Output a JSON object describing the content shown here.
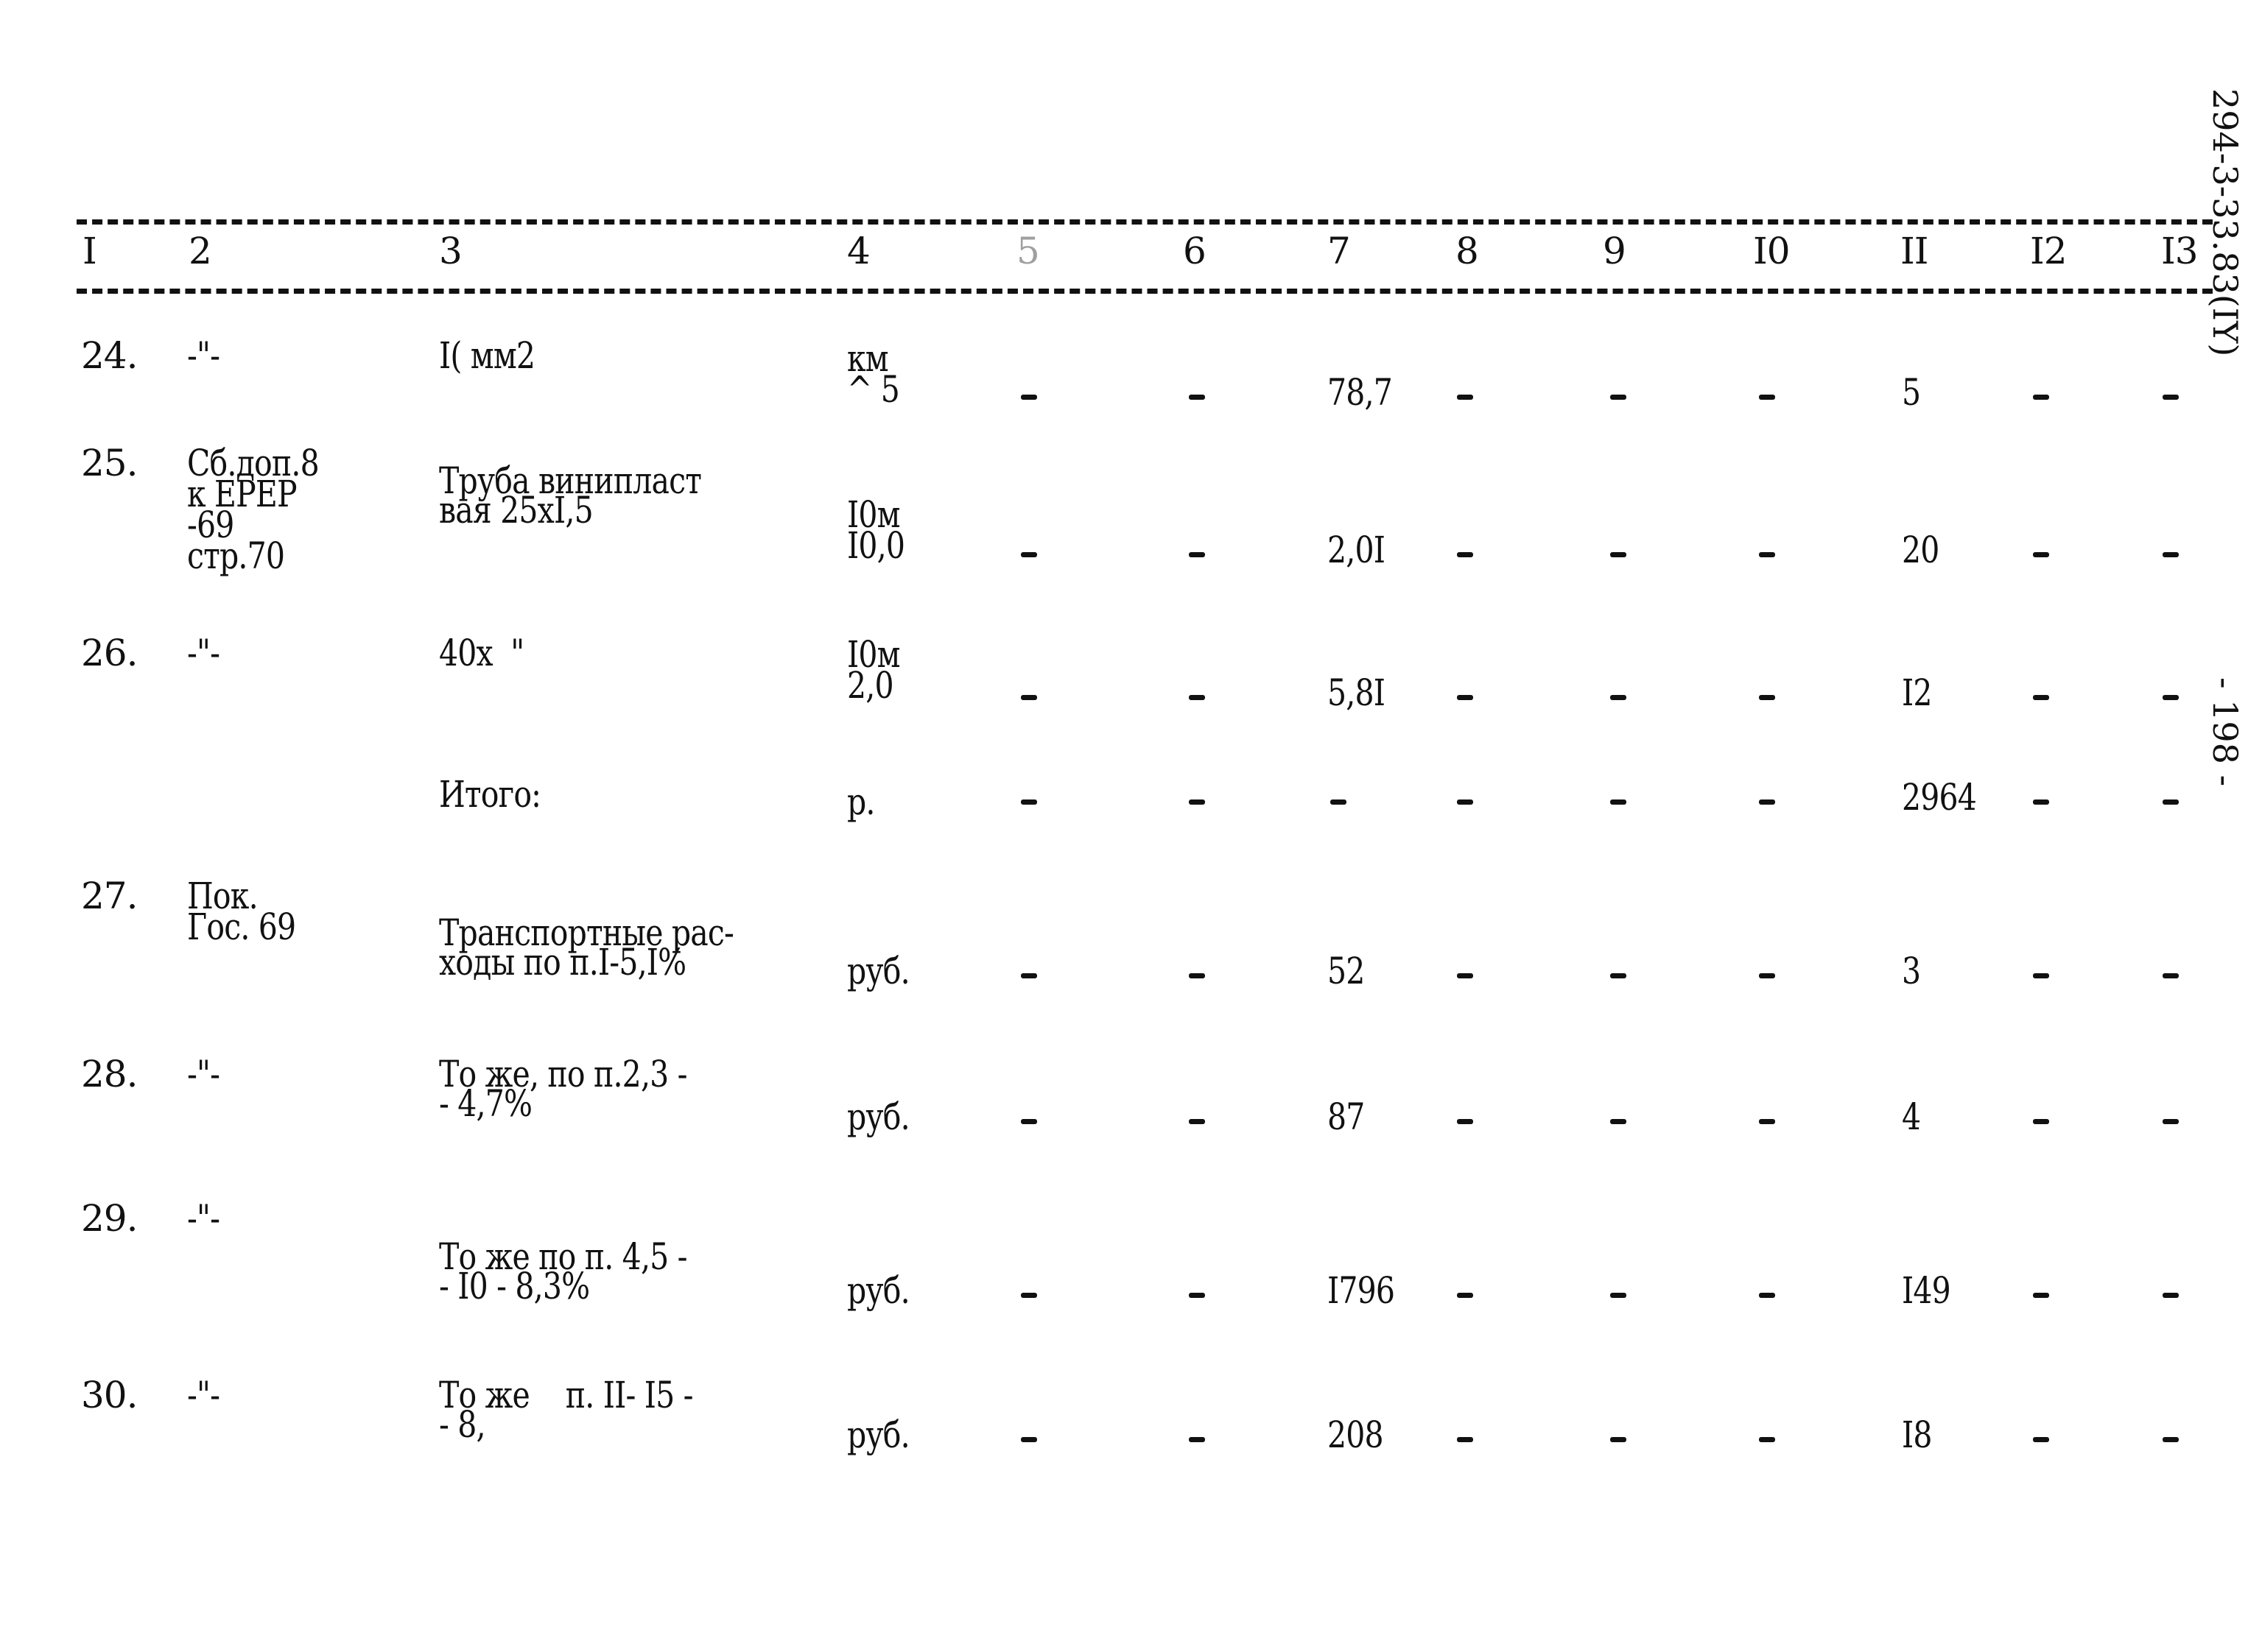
{
  "side_code": "294-3-33.83(IY)",
  "page_number": "- 198 -",
  "header": [
    "I",
    "2",
    "3",
    "4",
    "5",
    "6",
    "7",
    "8",
    "9",
    "I0",
    "II",
    "I2",
    "I3"
  ],
  "rows": [
    {
      "n": "24.",
      "src": [
        "-\"-"
      ],
      "name": [
        "I( мм2"
      ],
      "unit": [
        "км",
        "^ 5"
      ],
      "c7": "78,7",
      "c11": "5"
    },
    {
      "n": "25.",
      "src": [
        "Сб.доп.8",
        "к ЕРЕР",
        "-69",
        "стр.70"
      ],
      "name": [
        "Труба винипласт",
        "вая 25хI,5"
      ],
      "unit": [
        "I0м",
        "I0,0"
      ],
      "c7": "2,0I",
      "c11": "20"
    },
    {
      "n": "26.",
      "src": [
        "-\"-"
      ],
      "name": [
        "40х  \""
      ],
      "unit": [
        "I0м",
        "2,0"
      ],
      "c7": "5,8I",
      "c11": "I2"
    },
    {
      "n": "",
      "src": [],
      "name": [
        "Итого:"
      ],
      "unit": [
        "р."
      ],
      "c7": "-",
      "c11": "2964"
    },
    {
      "n": "27.",
      "src": [
        "Пок.",
        "Гос. 69"
      ],
      "name": [
        "Транспортные рас-",
        "ходы по п.I-5,I%"
      ],
      "unit": [
        "руб."
      ],
      "c7": "52",
      "c11": "3"
    },
    {
      "n": "28.",
      "src": [
        "-\"-"
      ],
      "name": [
        "То же, по п.2,3 -",
        "- 4,7%"
      ],
      "unit": [
        "руб."
      ],
      "c7": "87",
      "c11": "4"
    },
    {
      "n": "29.",
      "src": [
        "-\"-"
      ],
      "name": [
        "То же по п. 4,5 -",
        "- I0 - 8,3%"
      ],
      "unit": [
        "руб."
      ],
      "c7": "I796",
      "c11": "I49"
    },
    {
      "n": "30.",
      "src": [
        "-\"-"
      ],
      "name": [
        "То же    п. II- I5 -",
        "- 8,"
      ],
      "unit": [
        "руб."
      ],
      "c7": "208",
      "c11": "I8"
    }
  ],
  "dash": "-"
}
